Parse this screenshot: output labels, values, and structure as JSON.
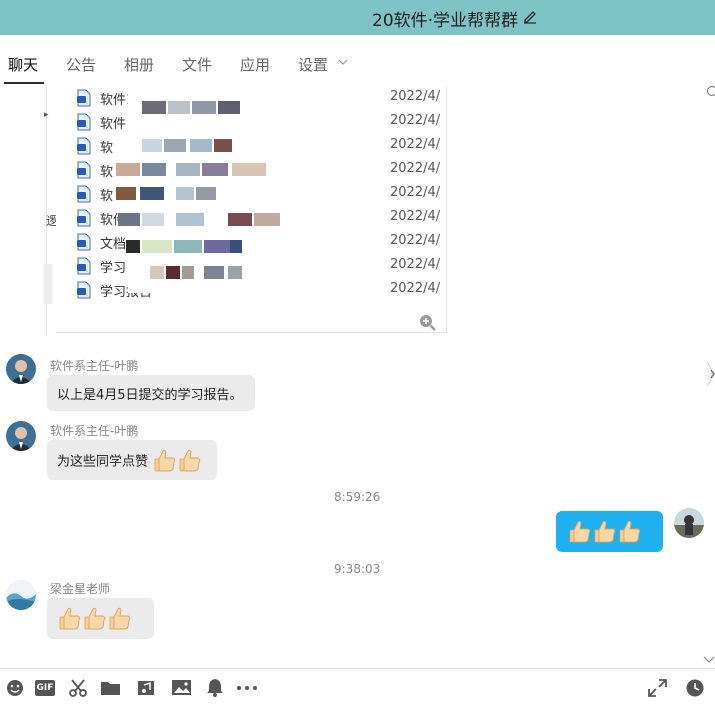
{
  "window": {
    "title": "20软件·学业帮帮群"
  },
  "tabs": [
    {
      "label": "聊天",
      "active": true
    },
    {
      "label": "公告"
    },
    {
      "label": "相册"
    },
    {
      "label": "文件"
    },
    {
      "label": "应用"
    },
    {
      "label": "设置"
    }
  ],
  "files": [
    {
      "name": "软件12",
      "date": "2022/4/",
      "icon": "file-word-icon"
    },
    {
      "name": "软件",
      "date": "2022/4/",
      "icon": "file-word-icon"
    },
    {
      "name": "软",
      "date": "2022/4/",
      "icon": "file-word-icon"
    },
    {
      "name": "软",
      "date": "2022/4/",
      "icon": "file-word-icon"
    },
    {
      "name": "软",
      "date": "2022/4/",
      "icon": "file-word-icon"
    },
    {
      "name": "软件",
      "date": "2022/4/",
      "icon": "file-word-icon"
    },
    {
      "name": "文档",
      "date": "2022/4/",
      "icon": "file-word-icon"
    },
    {
      "name": "学习",
      "date": "2022/4/",
      "icon": "file-word-icon"
    },
    {
      "name": "学习报告",
      "date": "2022/4/",
      "icon": "file-word-icon"
    }
  ],
  "messages": [
    {
      "sender": "软件系主任-叶鹏",
      "text": "以上是4月5日提交的学习报告。"
    },
    {
      "sender": "软件系主任-叶鹏",
      "text": "为这些同学点赞"
    },
    {
      "time": "8:59:26"
    },
    {
      "time": "9:38:03"
    },
    {
      "sender": "梁金星老师",
      "text": ""
    }
  ],
  "toolbar": {
    "gif_label": "GIF"
  },
  "colors": {
    "title_bar": "#7ec4c6",
    "my_bubble": "#1fb0ef",
    "other_bubble": "#ebebeb"
  }
}
